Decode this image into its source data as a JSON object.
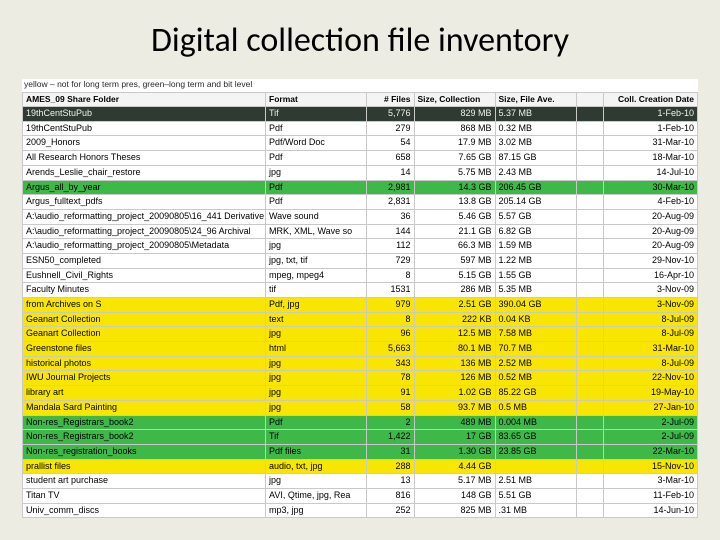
{
  "title": "Digital collection file inventory",
  "legend": "yellow – not for long term pres, green–long term and bit level",
  "columns": {
    "name": "AMES_09 Share Folder",
    "format": "Format",
    "files": "# Files",
    "size": "Size, Collection",
    "ave": "Size, File Ave.",
    "blank": "",
    "date": "Coll. Creation Date"
  },
  "rows": [
    {
      "hl": "dark",
      "name": "19thCentStuPub",
      "format": "Tif",
      "files": "5,776",
      "size": "829 MB",
      "ave": "5.37 MB",
      "date": "1-Feb-10"
    },
    {
      "hl": "",
      "name": "19thCentStuPub",
      "format": "Pdf",
      "files": "279",
      "size": "868 MB",
      "ave": "0.32 MB",
      "date": "1-Feb-10"
    },
    {
      "hl": "",
      "name": "2009_Honors",
      "format": "Pdf/Word Doc",
      "files": "54",
      "size": "17.9 MB",
      "ave": "3.02 MB",
      "date": "31-Mar-10"
    },
    {
      "hl": "",
      "name": "All Research Honors Theses",
      "format": "Pdf",
      "files": "658",
      "size": "7.65 GB",
      "ave": "87.15 GB",
      "date": "18-Mar-10"
    },
    {
      "hl": "",
      "name": "Arends_Leslie_chair_restore",
      "format": "jpg",
      "files": "14",
      "size": "5.75 MB",
      "ave": "2.43 MB",
      "date": "14-Jul-10"
    },
    {
      "hl": "green",
      "name": "Argus_all_by_year",
      "format": "Pdf",
      "files": "2,981",
      "size": "14.3 GB",
      "ave": "206.45 GB",
      "date": "30-Mar-10"
    },
    {
      "hl": "",
      "name": "Argus_fulltext_pdfs",
      "format": "Pdf",
      "files": "2,831",
      "size": "13.8 GB",
      "ave": "205.14 GB",
      "date": "4-Feb-10"
    },
    {
      "hl": "",
      "name": "A:\\audio_reformatting_project_20090805\\16_441 Derivative",
      "format": "Wave sound",
      "files": "36",
      "size": "5.46 GB",
      "ave": "5.57 GB",
      "date": "20-Aug-09"
    },
    {
      "hl": "",
      "name": "A:\\audio_reformatting_project_20090805\\24_96 Archival",
      "format": "MRK, XML, Wave so",
      "files": "144",
      "size": "21.1 GB",
      "ave": "6.82 GB",
      "date": "20-Aug-09"
    },
    {
      "hl": "",
      "name": "A:\\audio_reformatting_project_20090805\\Metadata",
      "format": "jpg",
      "files": "112",
      "size": "66.3 MB",
      "ave": "1.59 MB",
      "date": "20-Aug-09"
    },
    {
      "hl": "",
      "name": "ESN50_completed",
      "format": "jpg, txt, tif",
      "files": "729",
      "size": "597 MB",
      "ave": "1.22 MB",
      "date": "29-Nov-10"
    },
    {
      "hl": "",
      "name": "Eushnell_Civil_Rights",
      "format": "mpeg, mpeg4",
      "files": "8",
      "size": "5.15 GB",
      "ave": "1.55 GB",
      "date": "16-Apr-10"
    },
    {
      "hl": "",
      "name": "Faculty Minutes",
      "format": "tif",
      "files": "1531",
      "size": "286 MB",
      "ave": "5.35 MB",
      "date": "3-Nov-09"
    },
    {
      "hl": "yellow",
      "name": "from Archives on S",
      "format": "Pdf, jpg",
      "files": "979",
      "size": "2.51 GB",
      "ave": "390.04 GB",
      "date": "3-Nov-09"
    },
    {
      "hl": "yellow",
      "name": "Geanart Collection",
      "format": "text",
      "files": "8",
      "size": "222 KB",
      "ave": "0.04 KB",
      "date": "8-Jul-09"
    },
    {
      "hl": "yellow",
      "name": "Geanart Collection",
      "format": "jpg",
      "files": "96",
      "size": "12.5 MB",
      "ave": "7.58 MB",
      "date": "8-Jul-09"
    },
    {
      "hl": "yellow",
      "name": "Greenstone files",
      "format": "html",
      "files": "5,663",
      "size": "80.1 MB",
      "ave": "70.7 MB",
      "date": "31-Mar-10"
    },
    {
      "hl": "yellow",
      "name": "historical photos",
      "format": "jpg",
      "files": "343",
      "size": "136 MB",
      "ave": "2.52 MB",
      "date": "8-Jul-09"
    },
    {
      "hl": "yellow",
      "name": "IWU Journal Projects",
      "format": "jpg",
      "files": "78",
      "size": "126 MB",
      "ave": "0.52 MB",
      "date": "22-Nov-10"
    },
    {
      "hl": "yellow",
      "name": "library art",
      "format": "jpg",
      "files": "91",
      "size": "1.02 GB",
      "ave": "85.22 GB",
      "date": "19-May-10"
    },
    {
      "hl": "yellow",
      "name": "Mandala Sard Painting",
      "format": "jpg",
      "files": "58",
      "size": "93.7 MB",
      "ave": "0.5 MB",
      "date": "27-Jan-10"
    },
    {
      "hl": "green",
      "name": "Non-res_Registrars_book2",
      "format": "Pdf",
      "files": "2",
      "size": "489 MB",
      "ave": "0.004 MB",
      "date": "2-Jul-09"
    },
    {
      "hl": "green",
      "name": "Non-res_Registrars_book2",
      "format": "Tif",
      "files": "1,422",
      "size": "17 GB",
      "ave": "83.65 GB",
      "date": "2-Jul-09"
    },
    {
      "hl": "green",
      "name": "Non-res_registration_books",
      "format": "Pdf files",
      "files": "31",
      "size": "1.30 GB",
      "ave": "23.85 GB",
      "date": "22-Mar-10"
    },
    {
      "hl": "yellow2",
      "name": "prallist files",
      "format": "audio, txt, jpg",
      "files": "288",
      "size": "4.44 GB",
      "ave": "",
      "date": "15-Nov-10"
    },
    {
      "hl": "",
      "name": "student art purchase",
      "format": "jpg",
      "files": "13",
      "size": "5.17 MB",
      "ave": "2.51 MB",
      "date": "3-Mar-10"
    },
    {
      "hl": "",
      "name": "Titan TV",
      "format": "AVI, Qtime, jpg, Rea",
      "files": "816",
      "size": "148 GB",
      "ave": "5.51 GB",
      "date": "11-Feb-10"
    },
    {
      "hl": "",
      "name": "Univ_comm_discs",
      "format": "mp3, jpg",
      "files": "252",
      "size": "825 MB",
      "ave": ".31 MB",
      "date": "14-Jun-10"
    }
  ]
}
